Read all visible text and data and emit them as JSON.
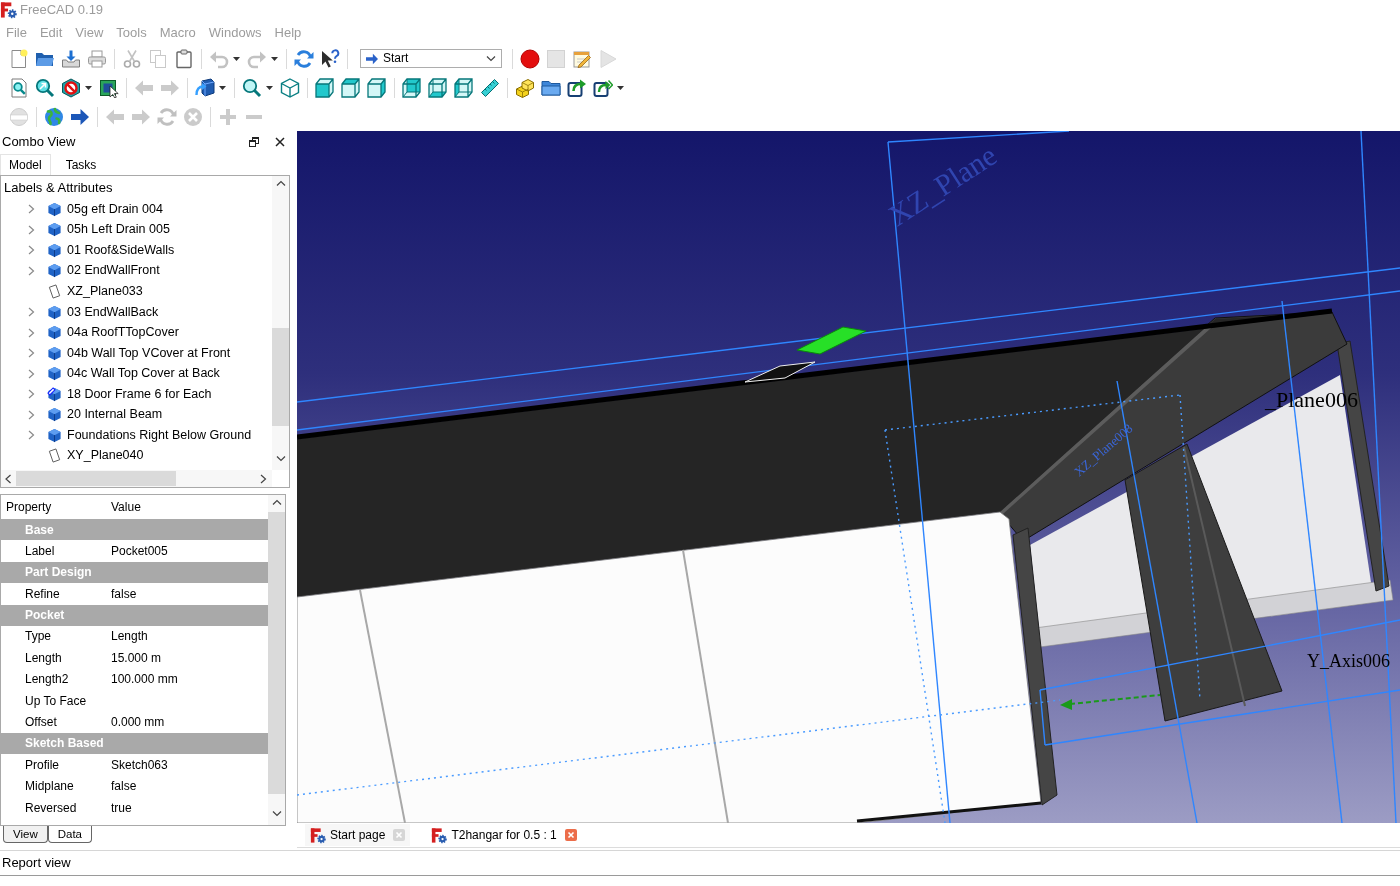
{
  "window": {
    "title": "FreeCAD 0.19",
    "active": false
  },
  "menu": [
    {
      "label": "File"
    },
    {
      "label": "Edit"
    },
    {
      "label": "View"
    },
    {
      "label": "Tools"
    },
    {
      "label": "Macro"
    },
    {
      "label": "Windows"
    },
    {
      "label": "Help"
    }
  ],
  "toolbars": [
    {
      "buttons": [
        {
          "disabled": false
        },
        {
          "disabled": false
        },
        {
          "disabled": false
        },
        {
          "disabled": false
        },
        {
          "disabled": true
        },
        {
          "disabled": true
        },
        {
          "disabled": false
        },
        {
          "disabled": true
        },
        {
          "disabled": true
        },
        {
          "disabled": false
        },
        {
          "disabled": false
        },
        {
          "disabled": false
        },
        {
          "disabled": true
        },
        {
          "disabled": false
        },
        {
          "disabled": true
        }
      ]
    },
    {
      "buttons": [
        {
          "disabled": false
        },
        {
          "disabled": false
        },
        {
          "disabled": false
        },
        {
          "disabled": false
        },
        {
          "disabled": true
        },
        {
          "disabled": true
        },
        {
          "disabled": false
        },
        {
          "disabled": false
        },
        {
          "disabled": false
        },
        {
          "disabled": false
        },
        {
          "disabled": false
        },
        {
          "disabled": false
        },
        {
          "disabled": false
        },
        {
          "disabled": false
        },
        {
          "disabled": false
        },
        {
          "disabled": false
        },
        {
          "disabled": false
        },
        {
          "disabled": false
        },
        {
          "disabled": false
        },
        {
          "disabled": false
        }
      ]
    },
    {
      "buttons": [
        {
          "disabled": true
        },
        {
          "disabled": false
        },
        {
          "disabled": false
        },
        {
          "disabled": true
        },
        {
          "disabled": true
        },
        {
          "disabled": true
        },
        {
          "disabled": true
        },
        {
          "disabled": true
        },
        {
          "disabled": true
        }
      ]
    }
  ],
  "workbench_selector": {
    "value": "Start"
  },
  "combo_view": {
    "title": "Combo View",
    "tabs": [
      {
        "label": "Model",
        "selected": true
      },
      {
        "label": "Tasks",
        "selected": false
      }
    ],
    "tree": {
      "header": "Labels & Attributes",
      "items": [
        {
          "label": "05g eft Drain 004",
          "kind": "body",
          "selected": false
        },
        {
          "label": "05h Left Drain 005",
          "kind": "body",
          "selected": false
        },
        {
          "label": "01 Roof&SideWalls",
          "kind": "body",
          "selected": false
        },
        {
          "label": "02 EndWallFront",
          "kind": "body",
          "selected": false
        },
        {
          "label": "XZ_Plane033",
          "kind": "plane",
          "selected": false
        },
        {
          "label": "03 EndWallBack",
          "kind": "body",
          "selected": false
        },
        {
          "label": "04a RoofTTopCover",
          "kind": "body",
          "selected": false
        },
        {
          "label": "04b Wall Top VCover at Front",
          "kind": "body",
          "selected": false
        },
        {
          "label": "04c Wall Top Cover at Back",
          "kind": "body",
          "selected": false
        },
        {
          "label": "18 Door Frame 6 for Each",
          "kind": "linked",
          "selected": false
        },
        {
          "label": "20 Internal Beam",
          "kind": "body",
          "selected": false
        },
        {
          "label": "Foundations Right Below Ground",
          "kind": "body",
          "selected": false
        },
        {
          "label": "XY_Plane040",
          "kind": "plane",
          "selected": false
        }
      ]
    },
    "properties": {
      "columns": [
        "Property",
        "Value"
      ],
      "groups": [
        {
          "name": "Base",
          "rows": [
            {
              "property": "Label",
              "value": "Pocket005"
            }
          ]
        },
        {
          "name": "Part Design",
          "rows": [
            {
              "property": "Refine",
              "value": "false"
            }
          ]
        },
        {
          "name": "Pocket",
          "rows": [
            {
              "property": "Type",
              "value": "Length"
            },
            {
              "property": "Length",
              "value": "15.000 m"
            },
            {
              "property": "Length2",
              "value": "100.000 mm"
            },
            {
              "property": "Up To Face"
            },
            {
              "property": "Offset",
              "value": "0.000 mm"
            }
          ]
        },
        {
          "name": "Sketch Based",
          "rows": [
            {
              "property": "Profile",
              "value": "Sketch063"
            },
            {
              "property": "Midplane",
              "value": "false"
            },
            {
              "property": "Reversed",
              "value": "true"
            }
          ]
        }
      ]
    },
    "property_tabs": [
      {
        "label": "View",
        "selected": false
      },
      {
        "label": "Data",
        "selected": true
      }
    ]
  },
  "viewport": {
    "labels": [
      "XZ_Plane",
      "XZ_Plane008",
      "_Plane006",
      "Y_Axis006"
    ]
  },
  "document_tabs": [
    {
      "label": "Start page",
      "selected": false
    },
    {
      "label": "T2hangar for 0.5 : 1",
      "selected": true
    }
  ],
  "report_view": {
    "title": "Report view"
  }
}
